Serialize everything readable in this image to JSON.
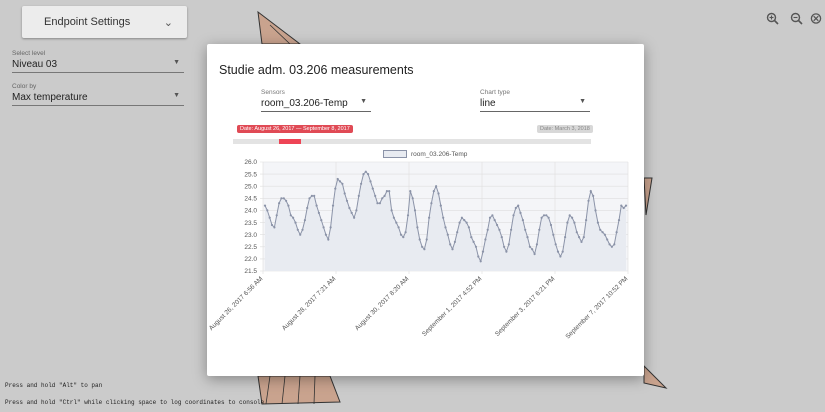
{
  "left_panel": {
    "endpoint_button": "Endpoint Settings",
    "level": {
      "label": "Select level",
      "value": "Niveau 03"
    },
    "color_by": {
      "label": "Color by",
      "value": "Max temperature"
    }
  },
  "toolbar": {
    "zoom_in_icon": "zoom-in-icon",
    "zoom_out_icon": "zoom-out-icon",
    "reset_icon": "reset-icon"
  },
  "modal": {
    "title": "Studie adm. 03.206 measurements",
    "sensors": {
      "label": "Sensors",
      "value": "room_03.206-Temp"
    },
    "chart_type": {
      "label": "Chart type",
      "value": "line"
    },
    "range_start_label": "Date: August 26, 2017 — September 8, 2017",
    "range_end_label": "Date: March 3, 2018"
  },
  "chart_data": {
    "type": "line",
    "series": [
      {
        "name": "room_03.206-Temp"
      }
    ],
    "ylim": [
      21.5,
      26.0
    ],
    "y_ticks": [
      "26.0",
      "25.5",
      "25.0",
      "24.5",
      "24.0",
      "23.5",
      "23.0",
      "22.5",
      "22.0",
      "21.5"
    ],
    "x_ticks": [
      "August 26, 2017 6:56 AM",
      "August 28, 2017 7:21 AM",
      "August 30, 2017 8:20 AM",
      "September 1, 2017 4:52 PM",
      "September 3, 2017 6:21 PM",
      "September 7, 2017 10:52 PM"
    ],
    "values": [
      24.2,
      24.0,
      23.7,
      23.4,
      23.3,
      23.8,
      24.3,
      24.5,
      24.5,
      24.4,
      24.2,
      23.8,
      23.7,
      23.5,
      23.2,
      23.0,
      23.2,
      23.6,
      24.1,
      24.5,
      24.6,
      24.6,
      24.2,
      23.9,
      23.6,
      23.3,
      23.0,
      22.8,
      23.3,
      24.2,
      24.9,
      25.3,
      25.2,
      25.1,
      24.7,
      24.4,
      24.1,
      23.9,
      23.7,
      24.0,
      24.6,
      25.1,
      25.5,
      25.6,
      25.5,
      25.2,
      24.9,
      24.6,
      24.3,
      24.3,
      24.5,
      24.6,
      24.8,
      24.8,
      24.0,
      23.7,
      23.5,
      23.3,
      23.0,
      22.9,
      23.1,
      23.8,
      24.8,
      24.5,
      24.0,
      23.3,
      22.8,
      22.5,
      22.4,
      22.8,
      23.7,
      24.3,
      24.8,
      25.0,
      24.7,
      24.2,
      23.7,
      23.3,
      23.0,
      22.6,
      22.4,
      22.7,
      23.1,
      23.5,
      23.7,
      23.6,
      23.5,
      23.3,
      22.9,
      22.7,
      22.5,
      22.1,
      21.9,
      22.3,
      22.8,
      23.2,
      23.7,
      23.8,
      23.6,
      23.4,
      23.2,
      22.9,
      22.5,
      22.3,
      22.6,
      23.2,
      23.8,
      24.1,
      24.2,
      23.9,
      23.6,
      23.2,
      22.9,
      22.5,
      22.4,
      22.2,
      22.6,
      23.2,
      23.7,
      23.8,
      23.8,
      23.7,
      23.4,
      23.0,
      22.6,
      22.3,
      22.1,
      22.3,
      22.9,
      23.5,
      23.8,
      23.7,
      23.5,
      23.1,
      22.9,
      22.7,
      22.9,
      23.6,
      24.4,
      24.8,
      24.6,
      24.0,
      23.5,
      23.2,
      23.1,
      23.0,
      22.8,
      22.6,
      22.5,
      22.6,
      23.1,
      23.6,
      24.2,
      24.1,
      24.2
    ],
    "grid": true,
    "line_color": "#8b93a8",
    "fill_color": "#e8ebf1"
  },
  "hints": {
    "pan": "Press and hold \"Alt\" to pan",
    "log": "Press and hold \"Ctrl\" while clicking space to log coordinates to console"
  }
}
